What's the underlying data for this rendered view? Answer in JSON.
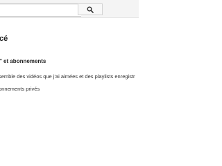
{
  "search": {
    "value": "",
    "placeholder": "",
    "button_icon": "search-icon"
  },
  "section": {
    "title": "cé"
  },
  "privacy": {
    "heading": "\" et abonnements",
    "option_liked_playlists": "semble des vidéos que j'ai aimées et des playlists enregistr",
    "option_subscriptions": "onnements privés"
  },
  "colors": {
    "topbar_bg": "#f4f4f4",
    "border": "#e6e6e6",
    "text": "#222222"
  }
}
